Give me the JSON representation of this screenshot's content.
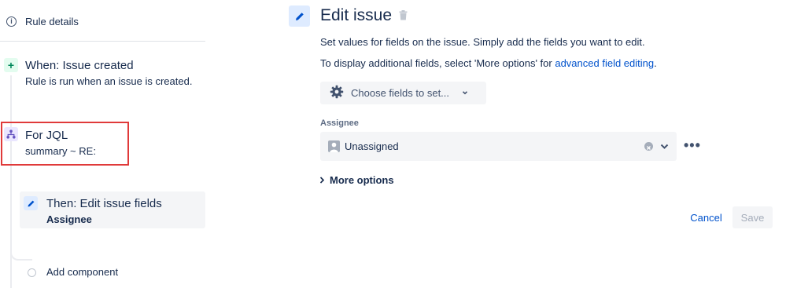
{
  "sidebar": {
    "rule_details": "Rule details",
    "trigger": {
      "title": "When: Issue created",
      "subtitle": "Rule is run when an issue is created."
    },
    "branch": {
      "title": "For JQL",
      "subtitle": "summary ~ RE:"
    },
    "action": {
      "title": "Then: Edit issue fields",
      "subtitle": "Assignee"
    },
    "add_component": "Add component"
  },
  "main": {
    "title": "Edit issue",
    "description_1": "Set values for fields on the issue. Simply add the fields you want to edit.",
    "description_2_prefix": "To display additional fields, select 'More options' for ",
    "description_2_link": "advanced field editing",
    "description_2_suffix": ".",
    "choose_fields_label": "Choose fields to set...",
    "assignee_label": "Assignee",
    "assignee_value": "Unassigned",
    "more_options_label": "More options",
    "cancel_label": "Cancel",
    "save_label": "Save"
  },
  "colors": {
    "highlight": "#e03a3a",
    "link": "#0052cc",
    "trigger_accent": "#00875a",
    "branch_accent": "#6554c0",
    "action_accent": "#0052cc"
  }
}
